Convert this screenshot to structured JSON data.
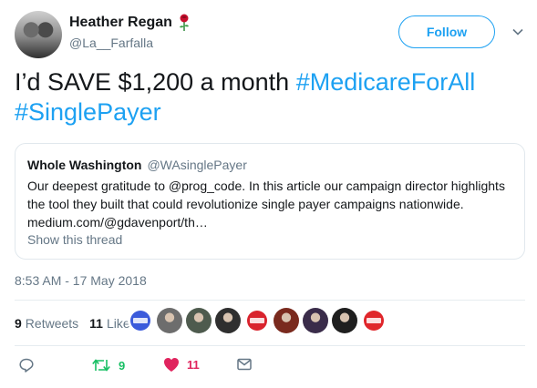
{
  "author": {
    "name": "Heather Regan",
    "handle": "@La__Farfalla",
    "emoji": "rose"
  },
  "follow_label": "Follow",
  "tweet": {
    "text": "I’d SAVE $1,200 a month ",
    "hashtag1": "#MedicareForAll",
    "hashtag2": "#SinglePayer"
  },
  "quote": {
    "name": "Whole Washington",
    "handle": "@WAsinglePayer",
    "line1": "Our deepest gratitude to @prog_code. In this article our campaign director highlights",
    "line2": "the tool they built that could revolutionize single payer campaigns nationwide.",
    "line3": "medium.com/@gdavenport/th…",
    "show_thread": "Show this thread"
  },
  "timestamp": "8:53 AM - 17 May 2018",
  "stats": {
    "retweets_count": "9",
    "retweets_label": "Retweets",
    "likes_count": "11",
    "likes_label": "Likes"
  },
  "liker_avatars": [
    {
      "kind": "badge",
      "color": "#3b5bdb"
    },
    {
      "kind": "face",
      "color": "#6d6d6d"
    },
    {
      "kind": "face",
      "color": "#4e5b4e"
    },
    {
      "kind": "face",
      "color": "#2f2f2f"
    },
    {
      "kind": "badge",
      "color": "#d9232d"
    },
    {
      "kind": "face",
      "color": "#7a2a1e"
    },
    {
      "kind": "face",
      "color": "#3a2c4a"
    },
    {
      "kind": "face",
      "color": "#1f1f1f"
    },
    {
      "kind": "badge",
      "color": "#e0262b"
    }
  ],
  "actions": {
    "retweet_count": "9",
    "like_count": "11"
  },
  "colors": {
    "accent": "#1da1f2",
    "retweet": "#17bf63",
    "like": "#e0245e",
    "muted": "#657786"
  }
}
